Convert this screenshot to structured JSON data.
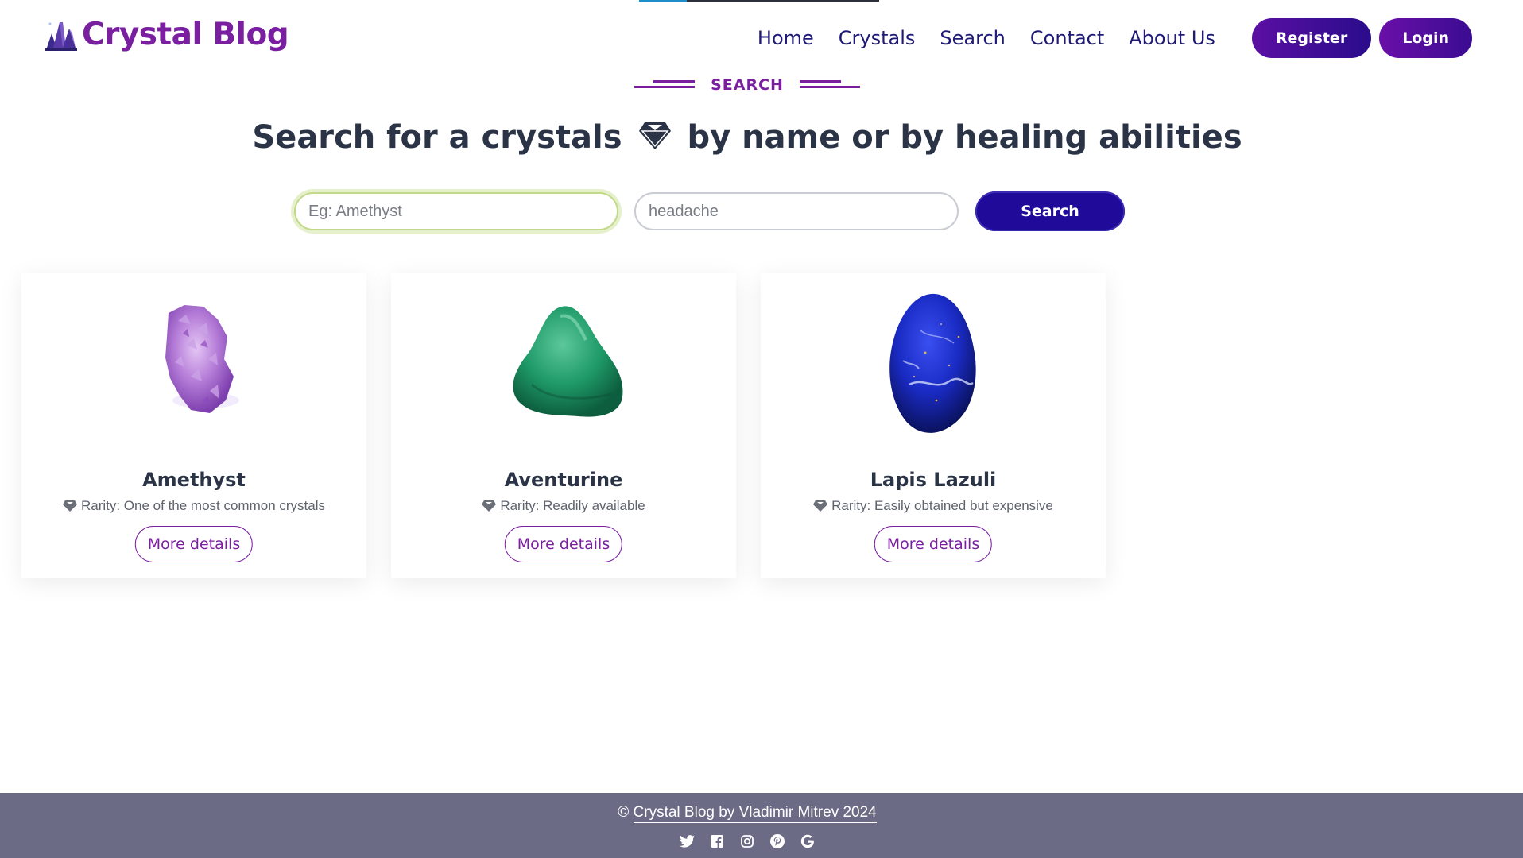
{
  "brand": {
    "name": "Crystal Blog"
  },
  "nav": {
    "links": [
      "Home",
      "Crystals",
      "Search",
      "Contact",
      "About Us"
    ],
    "register_label": "Register",
    "login_label": "Login"
  },
  "section": {
    "tag": "SEARCH"
  },
  "hero": {
    "heading_before": "Search for a crystals",
    "heading_after": "by name or by healing abilities"
  },
  "search": {
    "name_placeholder": "Eg: Amethyst",
    "name_value": "",
    "ability_placeholder": "headache",
    "ability_value": "",
    "button_label": "Search"
  },
  "results": [
    {
      "name": "Amethyst",
      "rarity": "Rarity: One of the most common crystals",
      "button": "More details",
      "image": "amethyst-crystal"
    },
    {
      "name": "Aventurine",
      "rarity": "Rarity: Readily available",
      "button": "More details",
      "image": "aventurine-stone"
    },
    {
      "name": "Lapis Lazuli",
      "rarity": "Rarity: Easily obtained but expensive",
      "button": "More details",
      "image": "lapis-lazuli-stone"
    }
  ],
  "footer": {
    "copyright_prefix": "© ",
    "copyright_link": "Crystal Blog by Vladimir Mitrev 2024",
    "socials": [
      "twitter-icon",
      "facebook-icon",
      "instagram-icon",
      "pinterest-icon",
      "google-icon"
    ]
  },
  "colors": {
    "brand": "#7a1fa0",
    "nav": "#1f1a78",
    "button": "#1f0a9a",
    "footer": "#6b6b86"
  }
}
